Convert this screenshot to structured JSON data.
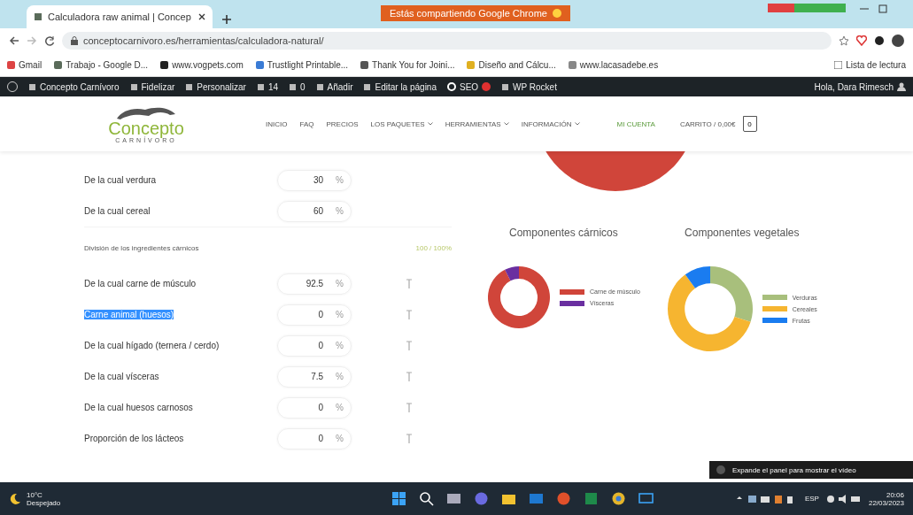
{
  "browser": {
    "tab": {
      "title": "Calculadora raw animal | Concep",
      "selected": true
    },
    "share_banner": "Estás compartiendo Google Chrome",
    "address": "conceptocarnivoro.es/herramientas/calculadora-natural/",
    "bookmarks": [
      "Gmail",
      "Trabajo - Google D...",
      "www.vogpets.com",
      "Trustlight Printable...",
      "Thank You for Joini...",
      "Diseño and Cálcu...",
      "www.lacasadebe.es"
    ],
    "reading_list": "Lista de lectura"
  },
  "admin_bar": {
    "items": [
      "Concepto Carnívoro",
      "Fidelizar",
      "Personalizar",
      "14",
      "0",
      "Añadir",
      "Editar la página",
      "SEO",
      "WP Rocket"
    ],
    "greeting": "Hola, Dara Rimesch"
  },
  "site_header": {
    "logo_text": "Concepto",
    "logo_subtext": "CARNÍVORO",
    "nav": [
      {
        "label": "INICIO",
        "dropdown": false
      },
      {
        "label": "FAQ",
        "dropdown": false
      },
      {
        "label": "PRECIOS",
        "dropdown": false
      },
      {
        "label": "LOS PAQUETES",
        "dropdown": true
      },
      {
        "label": "HERRAMIENTAS",
        "dropdown": true
      },
      {
        "label": "INFORMACIÓN",
        "dropdown": true
      }
    ],
    "account": "MI CUENTA",
    "cart": "CARRITO / 0,00€",
    "cart_count": "0"
  },
  "form": {
    "rows": [
      {
        "kind": "field",
        "label": "De la cual verdura",
        "value": "30",
        "unit": "%",
        "help": false,
        "selected": false
      },
      {
        "kind": "field",
        "label": "De la cual cereal",
        "value": "60",
        "unit": "%",
        "help": false,
        "selected": false
      },
      {
        "kind": "section",
        "label": "División de los ingredientes cárnicos",
        "total": "100 / 100%"
      },
      {
        "kind": "field",
        "label": "De la cual carne de músculo",
        "value": "92.5",
        "unit": "%",
        "help": true,
        "selected": false
      },
      {
        "kind": "field",
        "label": "Carne animal (huesos)",
        "value": "0",
        "unit": "%",
        "help": true,
        "selected": true
      },
      {
        "kind": "field",
        "label": "De la cual hígado (ternera / cerdo)",
        "value": "0",
        "unit": "%",
        "help": true,
        "selected": false
      },
      {
        "kind": "field",
        "label": "De la cual vísceras",
        "value": "7.5",
        "unit": "%",
        "help": true,
        "selected": false
      },
      {
        "kind": "field",
        "label": "De la cual huesos carnosos",
        "value": "0",
        "unit": "%",
        "help": true,
        "selected": false
      },
      {
        "kind": "field",
        "label": "Proporción de los lácteos",
        "value": "0",
        "unit": "%",
        "help": true,
        "selected": false
      }
    ]
  },
  "charts": [
    {
      "chart_data": {
        "type": "donut",
        "title": "Componentes cárnicos",
        "categories": [
          "Carne de músculo",
          "Vísceras"
        ],
        "values": [
          92.5,
          7.5
        ],
        "colors": [
          "#d0453a",
          "#6a2fa0"
        ],
        "legend": "right"
      }
    },
    {
      "chart_data": {
        "type": "donut",
        "title": "Componentes vegetales",
        "categories": [
          "Verduras",
          "Cereales",
          "Frutas"
        ],
        "values": [
          30,
          60,
          10
        ],
        "colors": [
          "#a8bf7c",
          "#f6b530",
          "#1a7cf0"
        ],
        "legend": "right"
      }
    }
  ],
  "video_hint": "Expande el panel para mostrar el vídeo",
  "taskbar": {
    "temperature": "10°C",
    "weather": "Despejado",
    "language": "ESP",
    "time": "20:06",
    "date": "22/03/2023"
  }
}
